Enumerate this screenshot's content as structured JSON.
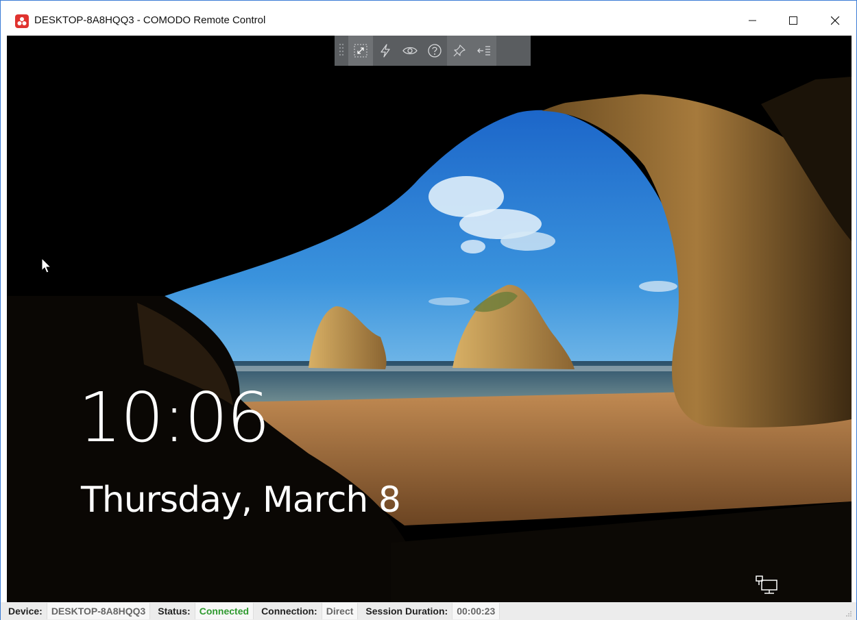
{
  "window": {
    "title": "DESKTOP-8A8HQQ3 - COMODO Remote Control"
  },
  "toolbar": {
    "items": [
      {
        "name": "fullscreen",
        "icon": "fullscreen-icon"
      },
      {
        "name": "actions",
        "icon": "lightning-icon"
      },
      {
        "name": "view-only",
        "icon": "eye-icon"
      },
      {
        "name": "help",
        "icon": "question-icon"
      },
      {
        "name": "pin",
        "icon": "pin-icon"
      },
      {
        "name": "collapse",
        "icon": "collapse-menu-icon"
      }
    ]
  },
  "lockscreen": {
    "time": "10:06",
    "date": "Thursday, March 8"
  },
  "statusbar": {
    "device_label": "Device:",
    "device_value": "DESKTOP-8A8HQQ3",
    "status_label": "Status:",
    "status_value": "Connected",
    "connection_label": "Connection:",
    "connection_value": "Direct",
    "duration_label": "Session Duration:",
    "duration_value": "00:00:23"
  },
  "colors": {
    "accent": "#e0332f",
    "status_ok": "#2f9a2f",
    "toolbar_bg": "#5a5d60"
  }
}
